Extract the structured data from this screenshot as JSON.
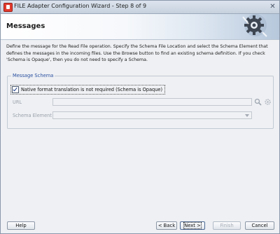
{
  "window": {
    "title": "FILE Adapter Configuration Wizard - Step 8 of 9",
    "close_glyph": "✕"
  },
  "header": {
    "title": "Messages",
    "icon": "gear-icon"
  },
  "description": "Define the message for the Read File operation.  Specify the Schema File Location and select the Schema Element that defines the messages in the incoming files. Use the Browse button to find an existing schema definition. If you check 'Schema is Opaque', then you do not need to specify a Schema.",
  "message_schema": {
    "legend": "Message Schema",
    "opaque_checkbox": {
      "checked": true,
      "label": "Native format translation is not required (Schema is Opaque)"
    },
    "url": {
      "label": "URL",
      "value": "",
      "enabled": false
    },
    "schema_element": {
      "label": "Schema Element",
      "value": "",
      "enabled": false
    },
    "search_icon": "search-icon",
    "settings_icon": "gear-icon"
  },
  "buttons": {
    "help": "Help",
    "back": "< Back",
    "next": "Next >",
    "finish": "Finish",
    "cancel": "Cancel"
  },
  "colors": {
    "legend": "#2a4fa0",
    "header_gradient_end": "#b7c8dc",
    "disabled_text": "#9aa1ab"
  }
}
